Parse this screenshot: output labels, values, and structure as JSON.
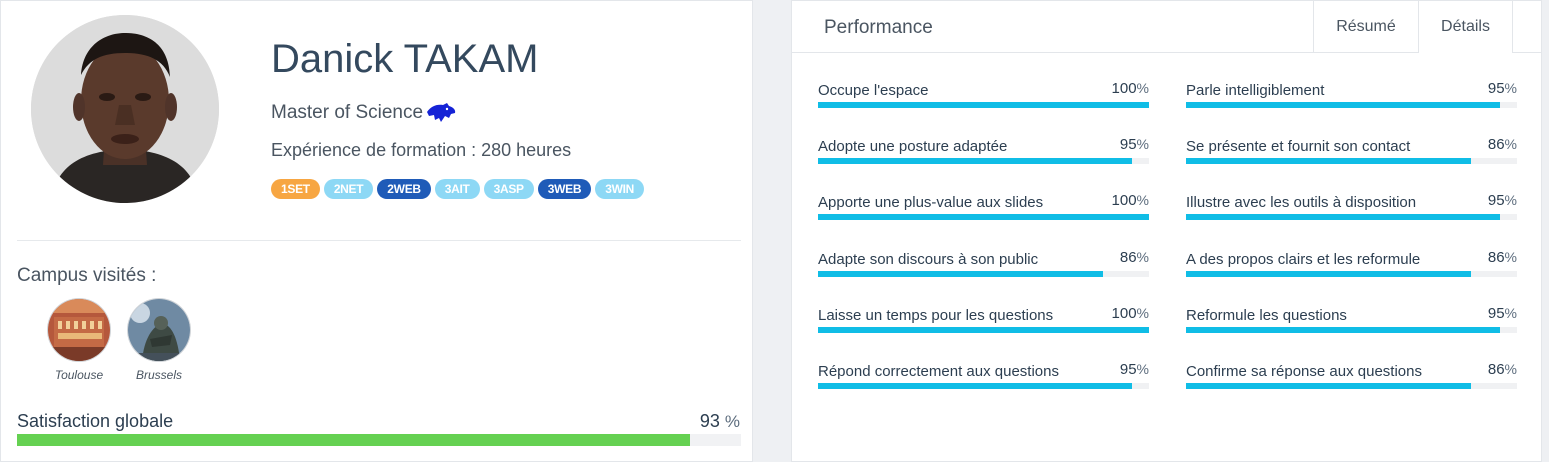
{
  "profile": {
    "name": "Danick TAKAM",
    "degree": "Master of Science",
    "experience": "Expérience de formation : 280 heures",
    "badges": [
      {
        "label": "1SET",
        "color": "#f7a642"
      },
      {
        "label": "2NET",
        "color": "#8dd8f5"
      },
      {
        "label": "2WEB",
        "color": "#1f5bb8"
      },
      {
        "label": "3AIT",
        "color": "#8dd8f5"
      },
      {
        "label": "3ASP",
        "color": "#8dd8f5"
      },
      {
        "label": "3WEB",
        "color": "#1f5bb8"
      },
      {
        "label": "3WIN",
        "color": "#8dd8f5"
      }
    ]
  },
  "campus": {
    "title": "Campus visités :",
    "items": [
      {
        "label": "Toulouse"
      },
      {
        "label": "Brussels"
      }
    ]
  },
  "satisfaction": {
    "label": "Satisfaction globale",
    "value": "93",
    "unit": "%",
    "fraction": 0.93,
    "color": "#65d152"
  },
  "performance": {
    "title": "Performance",
    "tabs": [
      {
        "label": "Résumé"
      },
      {
        "label": "Détails"
      }
    ],
    "active_tab": "Détails",
    "bar_color": "#10bde6",
    "skills": [
      {
        "label": "Occupe l'espace",
        "value": "100",
        "fraction": 1.0
      },
      {
        "label": "Parle intelligiblement",
        "value": "95",
        "fraction": 0.95
      },
      {
        "label": "Adopte une posture adaptée",
        "value": "95",
        "fraction": 0.95
      },
      {
        "label": "Se présente et fournit son contact",
        "value": "86",
        "fraction": 0.86
      },
      {
        "label": "Apporte une plus-value aux slides",
        "value": "100",
        "fraction": 1.0
      },
      {
        "label": "Illustre avec les outils à disposition",
        "value": "95",
        "fraction": 0.95
      },
      {
        "label": "Adapte son discours à son public",
        "value": "86",
        "fraction": 0.86
      },
      {
        "label": "A des propos clairs et les reformule",
        "value": "86",
        "fraction": 0.86
      },
      {
        "label": "Laisse un temps pour les questions",
        "value": "100",
        "fraction": 1.0
      },
      {
        "label": "Reformule les questions",
        "value": "95",
        "fraction": 0.95
      },
      {
        "label": "Répond correctement aux questions",
        "value": "95",
        "fraction": 0.95
      },
      {
        "label": "Confirme sa réponse aux questions",
        "value": "86",
        "fraction": 0.86
      }
    ],
    "percent_sign": "%"
  }
}
